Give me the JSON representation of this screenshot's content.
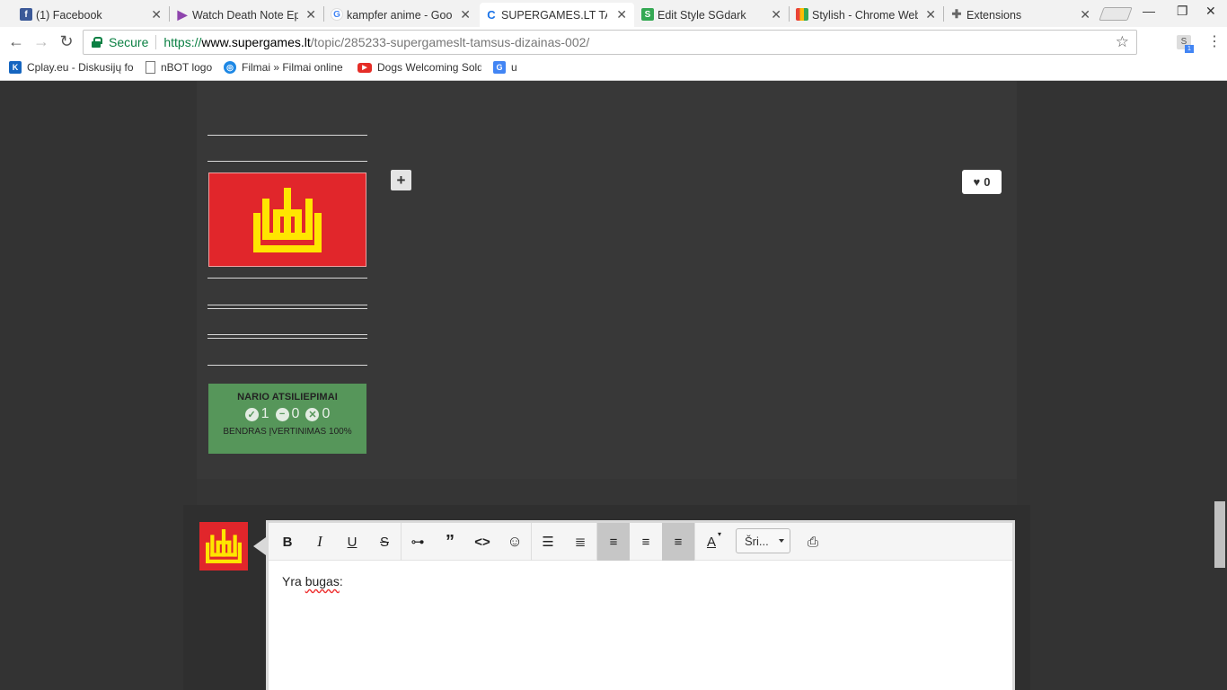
{
  "tabs": [
    {
      "title": "(1) Facebook",
      "icon": "facebook-icon",
      "color": "#3b5998"
    },
    {
      "title": "Watch Death Note Ep",
      "icon": "play-icon",
      "color": "#8e44ad"
    },
    {
      "title": "kampfer anime - Goo",
      "icon": "google-icon",
      "color": "#4285f4"
    },
    {
      "title": "SUPERGAMES.LT TA",
      "icon": "supergames-icon",
      "color": "#1a73e8"
    },
    {
      "title": "Edit Style SGdark",
      "icon": "stylish-icon",
      "color": "#34a853"
    },
    {
      "title": "Stylish - Chrome Web",
      "icon": "webstore-icon",
      "color": "#ea4335"
    },
    {
      "title": "Extensions",
      "icon": "puzzle-icon",
      "color": "#666666"
    }
  ],
  "omnibox": {
    "secure_label": "Secure",
    "url_scheme": "https://",
    "url_host": "www.supergames.lt",
    "url_path": "/topic/285233-supergameslt-tamsus-dizainas-002/"
  },
  "extension_badge": "1",
  "extension_letter": "S",
  "bookmarks": [
    {
      "label": "Cplay.eu - Diskusijų fo",
      "icon": "cplay-icon",
      "color": "#1565c0"
    },
    {
      "label": "nBOT logo",
      "icon": "page-icon",
      "color": "#ffffff"
    },
    {
      "label": "Filmai » Filmai online",
      "icon": "filmai-icon",
      "color": "#1e88e5"
    },
    {
      "label": "Dogs Welcoming Sold",
      "icon": "youtube-icon",
      "color": "#e52d27"
    },
    {
      "label": "u",
      "icon": "translate-icon",
      "color": "#4285f4"
    }
  ],
  "post": {
    "like_count": "0",
    "reputation": {
      "title": "NARIO ATSILIEPIMAI",
      "positive": "1",
      "neutral": "0",
      "negative": "0",
      "overall": "BENDRAS ĮVERTINIMAS 100%"
    }
  },
  "editor": {
    "font_select": "Šri...",
    "text_prefix": "Yra ",
    "text_misspelled": "bugas",
    "text_suffix": ":"
  },
  "colors": {
    "flag_red": "#e1262b",
    "flag_yellow": "#ffe600",
    "rep_green": "#56965a",
    "secure_green": "#0b8043"
  }
}
